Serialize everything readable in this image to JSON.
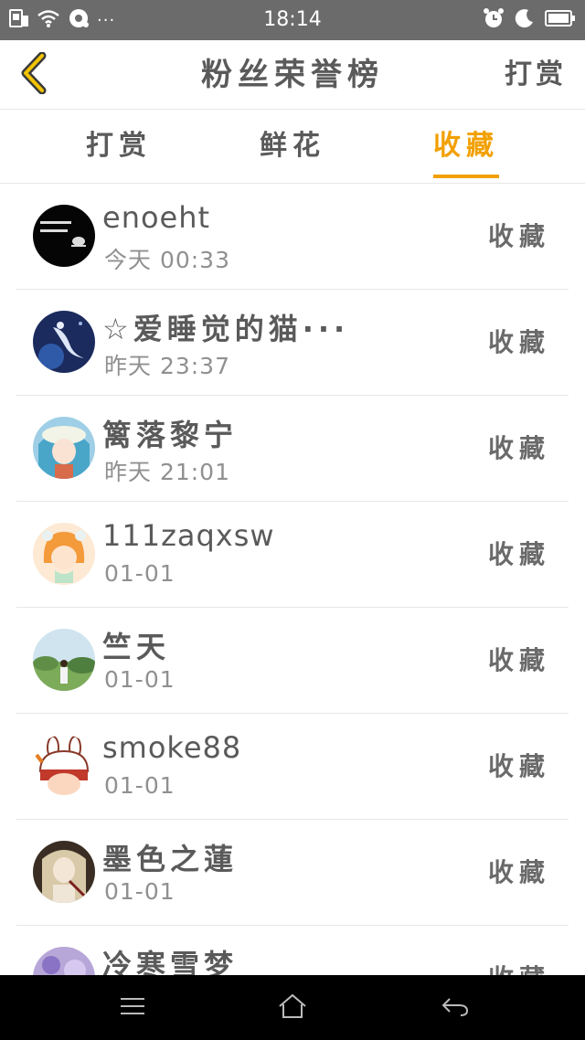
{
  "status_bar": {
    "time": "18:14",
    "left_icons": [
      "sim-icon",
      "wifi-icon",
      "sync-icon"
    ],
    "more": "···",
    "right_icons": [
      "alarm-icon",
      "moon-icon",
      "battery-icon"
    ]
  },
  "header": {
    "title": "粉丝荣誉榜",
    "right_action": "打赏",
    "accent_color": "#f2a000"
  },
  "tabs": [
    {
      "label": "打赏",
      "active": false
    },
    {
      "label": "鲜花",
      "active": false
    },
    {
      "label": "收藏",
      "active": true
    }
  ],
  "list": [
    {
      "name": "enoeht",
      "time": "今天 00:33",
      "action": "收藏",
      "avatar": "avatar-black-text"
    },
    {
      "name": "☆爱睡觉的猫···",
      "time": "昨天 23:37",
      "action": "收藏",
      "avatar": "avatar-blue-bird"
    },
    {
      "name": "篱落黎宁",
      "time": "昨天 21:01",
      "action": "收藏",
      "avatar": "avatar-anime-girl"
    },
    {
      "name": "111zaqxsw",
      "time": "01-01",
      "action": "收藏",
      "avatar": "avatar-orange-cartoon"
    },
    {
      "name": "竺天",
      "time": "01-01",
      "action": "收藏",
      "avatar": "avatar-outdoor-photo"
    },
    {
      "name": "smoke88",
      "time": "01-01",
      "action": "收藏",
      "avatar": "avatar-bunny-cartoon"
    },
    {
      "name": "墨色之蓮",
      "time": "01-01",
      "action": "收藏",
      "avatar": "avatar-dark-anime"
    },
    {
      "name": "冷寒雪梦",
      "time": "",
      "action": "收藏",
      "avatar": "avatar-purple-flower"
    }
  ],
  "navbar": {
    "buttons": [
      "menu-icon",
      "home-icon",
      "back-arrow-icon"
    ]
  }
}
